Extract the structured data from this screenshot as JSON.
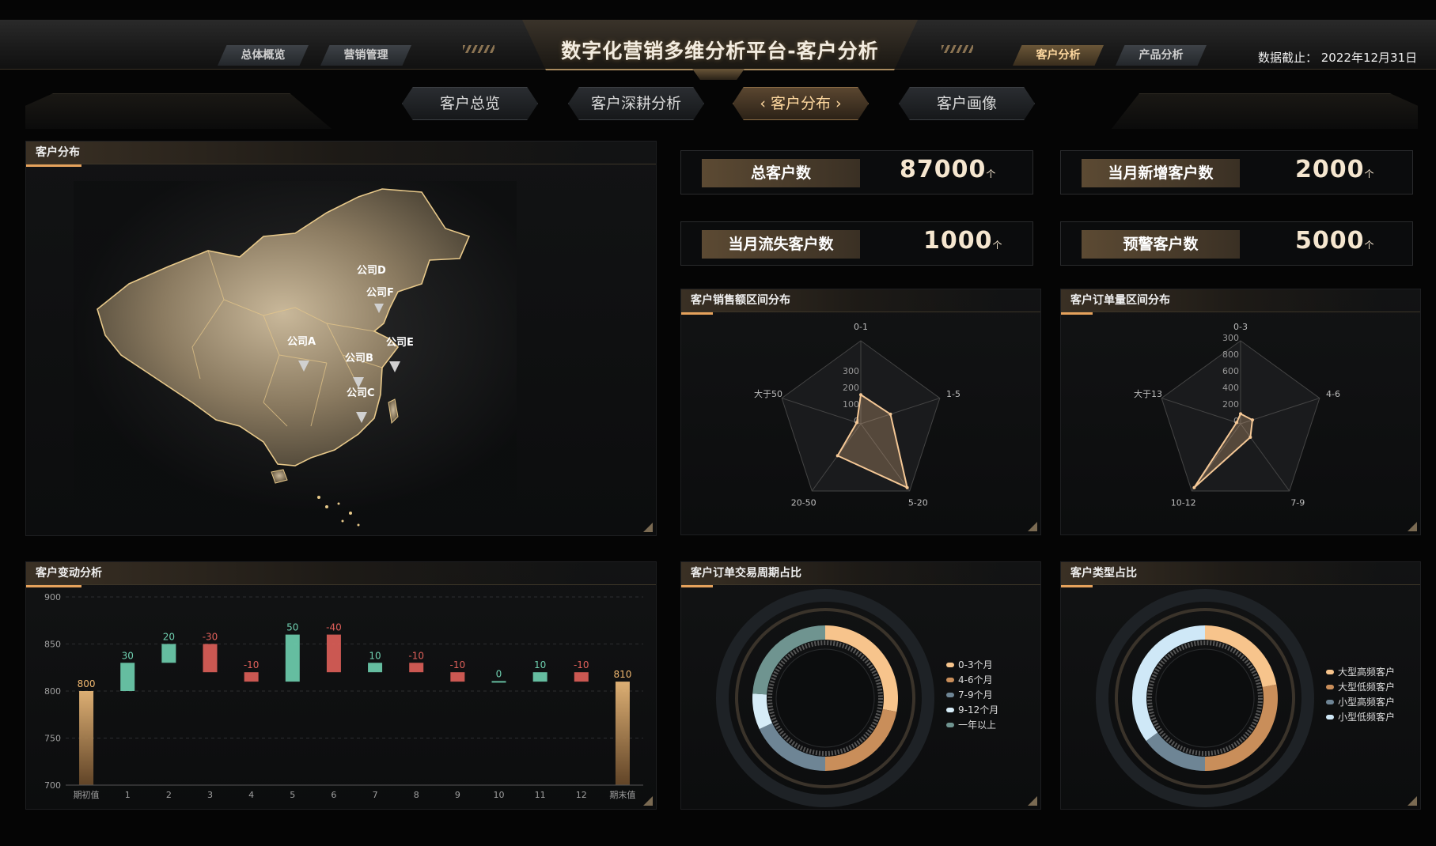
{
  "header": {
    "title": "数字化营销多维分析平台-客户分析",
    "left_nav": [
      {
        "label": "总体概览",
        "active": false
      },
      {
        "label": "营销管理",
        "active": false
      }
    ],
    "right_nav": [
      {
        "label": "客户分析",
        "active": true
      },
      {
        "label": "产品分析",
        "active": false
      }
    ],
    "data_date": "数据截止： 2022年12月31日"
  },
  "subnav": {
    "tabs": [
      {
        "label": "客户总览",
        "active": false
      },
      {
        "label": "客户深耕分析",
        "active": false
      },
      {
        "label": "客户分布",
        "active": true
      },
      {
        "label": "客户画像",
        "active": false
      }
    ]
  },
  "map_panel": {
    "title": "客户分布",
    "companies": [
      "公司D",
      "公司F",
      "公司A",
      "公司E",
      "公司B",
      "公司C"
    ]
  },
  "kpis": [
    {
      "label": "总客户数",
      "value": "87000",
      "unit": "个"
    },
    {
      "label": "当月新增客户数",
      "value": "2000",
      "unit": "个"
    },
    {
      "label": "当月流失客户数",
      "value": "1000",
      "unit": "个"
    },
    {
      "label": "预警客户数",
      "value": "5000",
      "unit": "个"
    }
  ],
  "radar_sales": {
    "title": "客户销售额区间分布",
    "chart_data": {
      "type": "radar",
      "axes": [
        "0-1",
        "1-5",
        "5-20",
        "20-50",
        "大于50"
      ],
      "ticks": [
        "0",
        "100",
        "200",
        "300"
      ],
      "max": 400,
      "values": [
        140,
        150,
        380,
        190,
        20
      ]
    }
  },
  "radar_orders": {
    "title": "客户订单量区间分布",
    "chart_data": {
      "type": "radar",
      "axes": [
        "0-3",
        "4-6",
        "7-9",
        "10-12",
        "大于13"
      ],
      "ticks": [
        "0",
        "200",
        "400",
        "600",
        "800",
        "300"
      ],
      "max": 1000,
      "values": [
        120,
        150,
        200,
        950,
        50
      ]
    }
  },
  "waterfall": {
    "title": "客户变动分析",
    "chart_data": {
      "type": "bar",
      "categories": [
        "期初值",
        "1",
        "2",
        "3",
        "4",
        "5",
        "6",
        "7",
        "8",
        "9",
        "10",
        "11",
        "12",
        "期末值"
      ],
      "values": [
        800,
        30,
        20,
        -30,
        -10,
        50,
        -40,
        10,
        -10,
        -10,
        0,
        10,
        -10,
        810
      ],
      "labels": [
        "800",
        "30",
        "20",
        "-30",
        "-10",
        "50",
        "-40",
        "10",
        "-10",
        "-10",
        "0",
        "10",
        "-10",
        "810"
      ],
      "ylim": [
        700,
        900
      ],
      "yticks": [
        "700",
        "750",
        "800",
        "850",
        "900"
      ]
    }
  },
  "donut_cycle": {
    "title": "客户订单交易周期占比",
    "chart_data": {
      "type": "pie",
      "labels": [
        "0-3个月",
        "4-6个月",
        "7-9个月",
        "9-12个月",
        "一年以上"
      ],
      "values": [
        28,
        22,
        18,
        8,
        24
      ],
      "colors": [
        "#f7c48c",
        "#c98e5a",
        "#6e8595",
        "#d6ecf7",
        "#6f9490"
      ]
    }
  },
  "donut_type": {
    "title": "客户类型占比",
    "chart_data": {
      "type": "pie",
      "labels": [
        "大型高频客户",
        "大型低频客户",
        "小型高频客户",
        "小型低频客户"
      ],
      "values": [
        22,
        28,
        15,
        35
      ],
      "colors": [
        "#f7c48c",
        "#c98e5a",
        "#6e8595",
        "#cfe8f7"
      ]
    }
  },
  "colors": {
    "accent": "#e6a25c",
    "positive_bar": "#6fd0b0",
    "negative_bar": "#e0605a",
    "endpoint_bar": "#f0b870"
  }
}
